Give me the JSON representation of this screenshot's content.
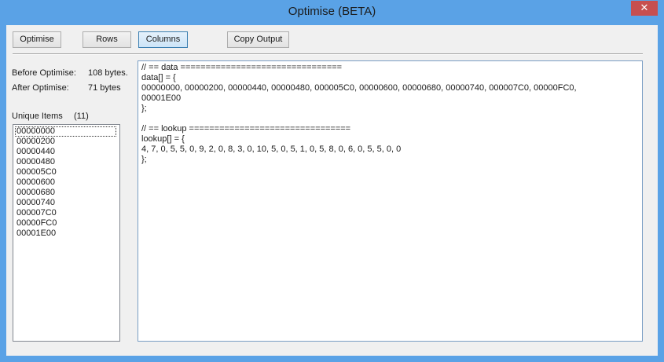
{
  "window": {
    "title": "Optimise (BETA)",
    "close_glyph": "✕"
  },
  "toolbar": {
    "optimise_label": "Optimise",
    "rows_label": "Rows",
    "columns_label": "Columns",
    "copy_label": "Copy Output"
  },
  "stats": {
    "before_label": "Before Optimise:",
    "before_value": "108 bytes.",
    "after_label": "After Optimise:",
    "after_value": "71 bytes",
    "unique_label": "Unique Items",
    "unique_count": "(11)"
  },
  "unique_items": [
    "00000000",
    "00000200",
    "00000440",
    "00000480",
    "000005C0",
    "00000600",
    "00000680",
    "00000740",
    "000007C0",
    "00000FC0",
    "00001E00"
  ],
  "output_lines": [
    "// == data ================================",
    "data[] = {",
    "00000000, 00000200, 00000440, 00000480, 000005C0, 00000600, 00000680, 00000740, 000007C0, 00000FC0,",
    "00001E00",
    "};",
    "",
    "// == lookup ================================",
    "lookup[] = {",
    "4, 7, 0, 5, 5, 0, 9, 2, 0, 8, 3, 0, 10, 5, 0, 5, 1, 0, 5, 8, 0, 6, 0, 5, 5, 0, 0",
    "};"
  ],
  "colors": {
    "titlebar": "#5aa2e6",
    "close_button": "#c74f4f",
    "active_button": "#cce4f7"
  }
}
